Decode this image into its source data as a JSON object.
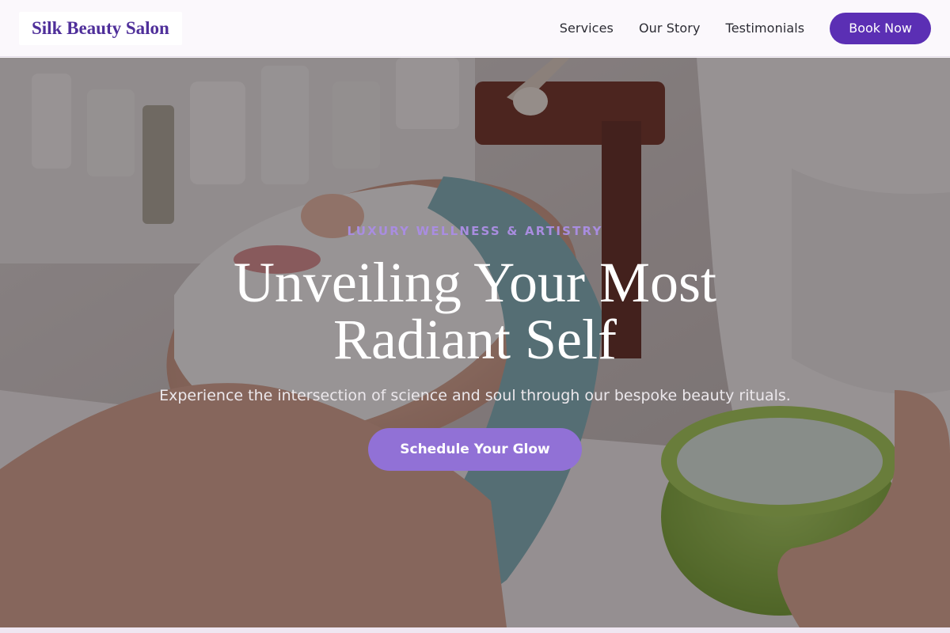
{
  "header": {
    "logo": "Silk Beauty Salon",
    "nav": [
      "Services",
      "Our Story",
      "Testimonials"
    ],
    "cta_label": "Book Now"
  },
  "hero": {
    "eyebrow": "LUXURY WELLNESS & ARTISTRY",
    "headline_line1": "Unveiling Your Most",
    "headline_line2": "Radiant Self",
    "subtext": "Experience the intersection of science and soul through our bespoke beauty rituals.",
    "cta_label": "Schedule Your Glow",
    "image_description_icon": "facial-treatment-photo"
  },
  "colors": {
    "brand": "#4f2f9a",
    "button": "#5b2fb4",
    "cta": "#9171d6",
    "eyebrow": "#a98de0"
  }
}
